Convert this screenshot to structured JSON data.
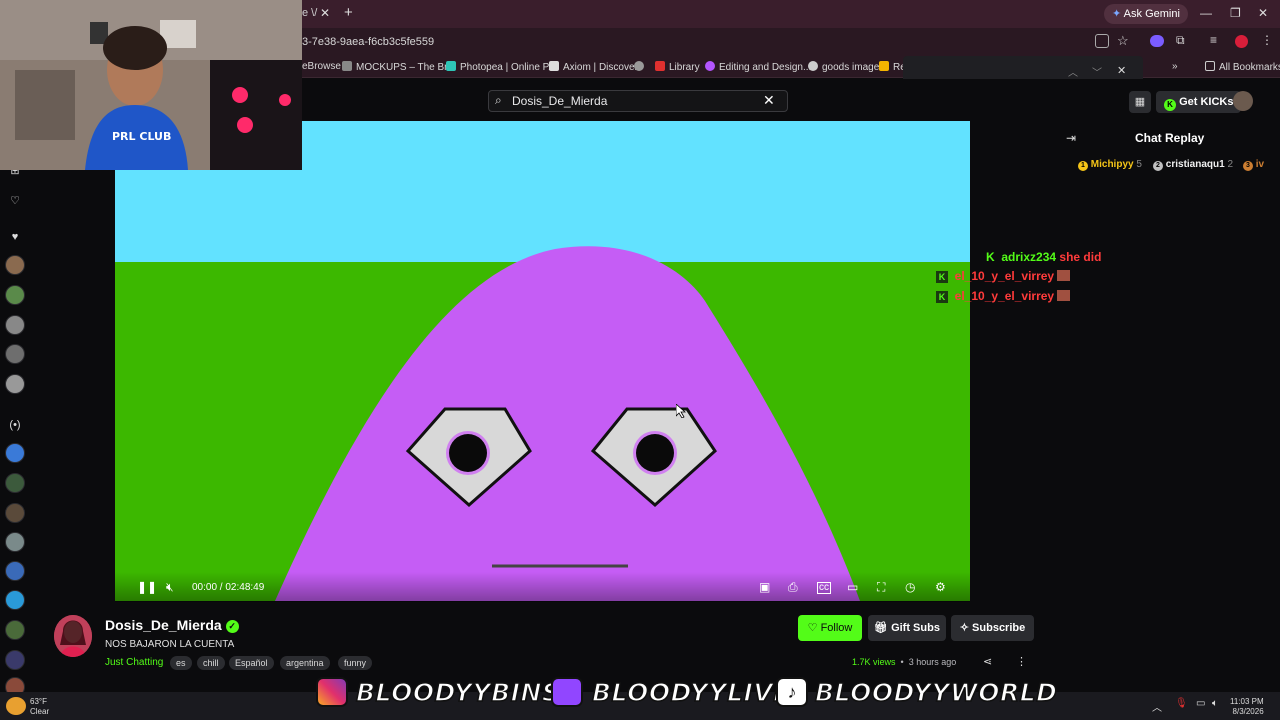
{
  "browser": {
    "tab_fragment": "e \\/",
    "ask_gemini": "Ask Gemini",
    "url_fragment": "3-7e38-9aea-f6cb3c5fe559",
    "bookmarks": [
      "eBrowse",
      "MOCKUPS – The Br...",
      "Photopea | Online P...",
      "Axiom | Discover",
      "Library",
      "Editing and Design...",
      "goods image",
      "Re"
    ],
    "all_bookmarks": "All Bookmarks"
  },
  "header": {
    "search_value": "Dosis_De_Mierda",
    "get_kicks": "Get KICKs"
  },
  "player": {
    "time": "00:00 / 02:48:49"
  },
  "chat": {
    "title": "Chat Replay",
    "gifters": [
      {
        "name": "Michipyy",
        "count": "5",
        "rank": "1",
        "color": "#f5c518"
      },
      {
        "name": "cristianaqu1",
        "count": "2",
        "rank": "2",
        "color": "#c0c0c0"
      },
      {
        "name": "iv",
        "count": "",
        "rank": "3",
        "color": "#cd7f32"
      }
    ],
    "messages": [
      {
        "user": "adrixz234",
        "text": "she did",
        "user_color": "#53fc18",
        "text_color": "#ff3b3b"
      },
      {
        "user": "el_10_y_el_virrey",
        "text": "",
        "user_color": "#ff3b3b",
        "text_color": "#ff3b3b"
      },
      {
        "user": "el_10_y_el_virrey",
        "text": "",
        "user_color": "#ff3b3b",
        "text_color": "#ff3b3b"
      }
    ]
  },
  "channel": {
    "name": "Dosis_De_Mierda",
    "title": "NOS BAJARON LA CUENTA",
    "category": "Just Chatting",
    "tags": [
      "es",
      "chill",
      "Español",
      "argentina",
      "funny"
    ],
    "follow": "Follow",
    "gift_subs": "Gift Subs",
    "subscribe": "Subscribe",
    "views": "1.7K views",
    "ago": "3 hours ago"
  },
  "banner": {
    "handles": [
      "BLOODYYBINS",
      "BLOODYYLIVE",
      "BLOODYYWORLD"
    ]
  },
  "taskbar": {
    "temp": "63°F",
    "weather": "Clear",
    "time": "11:03 PM",
    "date": "8/3/2026"
  },
  "colors": {
    "brand": "#53fc18",
    "sky": "#62e2ff",
    "grass": "#3cb800",
    "blob": "#c55df5"
  }
}
